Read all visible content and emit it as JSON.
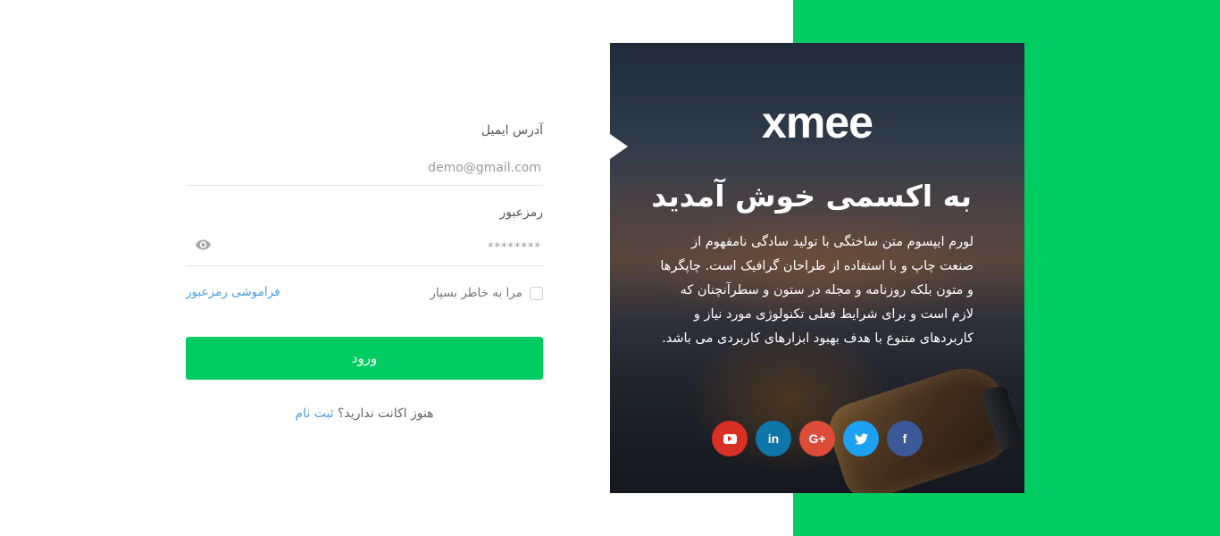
{
  "brand": {
    "logo_text": "xmee",
    "accent_color": "#00cc61"
  },
  "welcome": {
    "heading": "به اکسمی خوش آمدید",
    "body": "لورم ایپسوم متن ساختگی با تولید سادگی نامفهوم از صنعت چاپ و با استفاده از طراحان گرافیک است. چاپگرها و متون بلکه روزنامه و مجله در ستون و سطرآنچنان که لازم است و برای شرایط فعلی تکنولوژی مورد نیاز و کاربردهای متنوع با هدف بهبود ابزارهای کاربردی می باشد."
  },
  "social": [
    {
      "icon": "youtube-icon",
      "color": "#d93025"
    },
    {
      "icon": "linkedin-icon",
      "label": "in",
      "color": "#0e76a8"
    },
    {
      "icon": "google-plus-icon",
      "label": "G+",
      "color": "#dd4b39"
    },
    {
      "icon": "twitter-icon",
      "color": "#1da1f2"
    },
    {
      "icon": "facebook-icon",
      "label": "f",
      "color": "#3b5998"
    }
  ],
  "form": {
    "email_label": "آدرس ایمیل",
    "email_placeholder": "demo@gmail.com",
    "password_label": "رمزعبور",
    "password_placeholder": "********",
    "remember_label": "مرا به خاطر بسپار",
    "forgot_label": "فراموشی رمزعبور",
    "submit_label": "ورود",
    "signup_prompt": "هنوز اکانت ندارید؟",
    "signup_link": "ثبت نام"
  }
}
